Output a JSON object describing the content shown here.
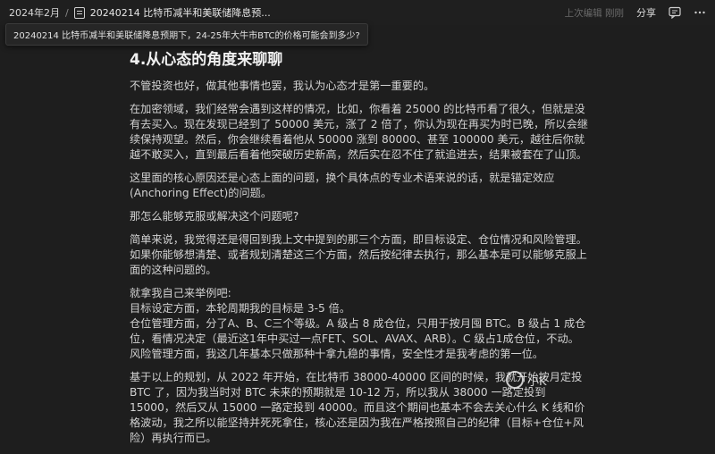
{
  "topbar": {
    "breadcrumb_root": "2024年2月",
    "breadcrumb_separator": "/",
    "breadcrumb_doc": "20240214 比特币减半和美联储降息预...",
    "last_edited": "上次编辑 刚刚",
    "share_label": "分享"
  },
  "tooltip": {
    "text": "20240214 比特币减半和美联储降息预期下，24-25年大牛市BTC的价格可能会到多少?"
  },
  "article": {
    "heading": "4.从心态的角度来聊聊",
    "paragraphs": [
      "不管投资也好，做其他事情也罢，我认为心态才是第一重要的。",
      "在加密领域，我们经常会遇到这样的情况，比如，你看着 25000 的比特币看了很久，但就是没有去买入。现在发现已经到了 50000 美元，涨了 2 倍了，你认为现在再买为时已晚，所以会继续保持观望。然后，你会继续看着他从 50000 涨到 80000、甚至 100000 美元，越往后你就越不敢买入，直到最后看着他突破历史新高，然后实在忍不住了就追进去，结果被套在了山顶。",
      "这里面的核心原因还是心态上面的问题，换个具体点的专业术语来说的话，就是锚定效应(Anchoring Effect)的问题。",
      "那怎么能够克服或解决这个问题呢?",
      "简单来说，我觉得还是得回到我上文中提到的那三个方面，即目标设定、仓位情况和风险管理。如果你能够想清楚、或者规划清楚这三个方面，然后按纪律去执行，那么基本是可以能够克服上面的这种问题的。"
    ],
    "example_lines": [
      "就拿我自己来举例吧:",
      "目标设定方面，本轮周期我的目标是 3-5 倍。",
      "仓位管理方面，分了A、B、C三个等级。A 级占 8 成仓位，只用于按月囤 BTC。B 级占 1 成仓位，看情况决定（最近这1年中买过一点FET、SOL、AVAX、ARB）。C 级占1成仓位，不动。",
      "风险管理方面，我这几年基本只做那种十拿九稳的事情，安全性才是我考虑的第一位。"
    ],
    "last_paragraph": "基于以上的规划，从 2022 年开始，在比特币 38000-40000 区间的时候，我就开始按月定投 BTC 了，因为我当时对 BTC 未来的预期就是 10-12 万，所以我从 38000 一路定投到 15000，然后又从 15000 一路定投到 40000。而且这个期间也基本不会去关心什么 K 线和价格波动，我之所以能坚持并死死拿住，核心还是因为我在严格按照自己的纪律（目标+仓位+风险）再执行而已。"
  },
  "watermark": {
    "text": "小K"
  }
}
